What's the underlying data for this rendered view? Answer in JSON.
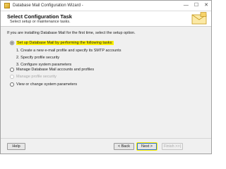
{
  "window": {
    "title": "Database Mail Configuration Wizard -"
  },
  "header": {
    "title": "Select Configuration Task",
    "subtitle": "Select setup or maintenance tasks."
  },
  "intro": "If you are installing Database Mail for the first time, select the setup option.",
  "options": {
    "setup": {
      "label": "Set up Database Mail by performing the following tasks:",
      "selected": true
    },
    "steps": [
      "1. Create a new e-mail profile and specify its SMTP accounts",
      "2. Specify profile security",
      "3. Configure system parameters"
    ],
    "manage_accounts": {
      "label": "Manage Database Mail accounts and profiles"
    },
    "manage_security": {
      "label": "Manage profile security"
    },
    "view_change": {
      "label": "View or change system parameters"
    }
  },
  "buttons": {
    "help": "Help",
    "back": "< Back",
    "next": "Next >",
    "finish": "Finish >>|"
  },
  "colors": {
    "highlight": "#fff200",
    "accent": "#2f74c9"
  }
}
